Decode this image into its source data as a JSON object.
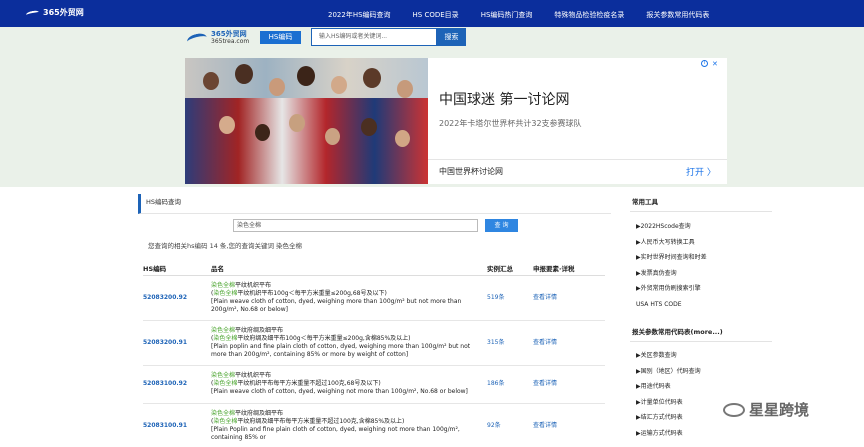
{
  "topbar": {
    "logo": "365外贸网",
    "nav": [
      "2022年HS编码查询",
      "HS CODE目录",
      "HS编码热门查询",
      "特殊物品检验检疫名录",
      "报关参数常用代码表"
    ]
  },
  "header": {
    "logo_name": "365外贸网",
    "logo_url": "365trea.com",
    "hs_button": "HS编码",
    "search_placeholder": "输入HS编码或者关键词...",
    "search_button": "搜索"
  },
  "ad": {
    "title": "中国球迷 第一讨论网",
    "subtitle": "2022年卡塔尔世界杯共计32支参赛球队",
    "footer": "中国世界杯讨论网",
    "open_button": "打开 〉",
    "close": "✕"
  },
  "main": {
    "tab": "HS编码查询",
    "query_value": "染色全棉",
    "query_button": "查 询",
    "result_summary": "您查询的相关hs编码 14 条,您的查询关键词 染色全棉",
    "columns": [
      "HS编码",
      "品名",
      "实例汇总",
      "申报要素·详税"
    ],
    "rows": [
      {
        "code": "52083200.92",
        "name_hl": "染色全棉",
        "name_rest": "平纹机织平布",
        "line2_hl": "染色全棉",
        "line2_rest": "平纹机织平布100g＜每平方米重量≤200g,68号及以下)",
        "english": "[Plain weave cloth of cotton, dyed, weighing more than 100g/m² but not more than 200g/m², No.68 or below]",
        "count": "519条",
        "detail": "查看详情"
      },
      {
        "code": "52083200.91",
        "name_hl": "染色全棉",
        "name_rest": "平纹府绸及细平布",
        "line2_hl": "染色全棉",
        "line2_rest": "平纹府绸及细平布100g＜每平方米重量≤200g,含棉85%及以上)",
        "english": "[Plain poplin and fine plain cloth of cotton, dyed, weighing more than 100g/m² but not more than 200g/m², containing 85% or more by weight of cotton]",
        "count": "315条",
        "detail": "查看详情"
      },
      {
        "code": "52083100.92",
        "name_hl": "染色全棉",
        "name_rest": "平纹机织平布",
        "line2_hl": "染色全棉",
        "line2_rest": "平纹机织平布每平方米重量不超过100克,68号及以下)",
        "english": "[Plain weave cloth of cotton, dyed, weighing not more than 100g/m², No.68 or below]",
        "count": "186条",
        "detail": "查看详情"
      },
      {
        "code": "52083100.91",
        "name_hl": "染色全棉",
        "name_rest": "平纹府绸及细平布",
        "line2_hl": "染色全棉",
        "line2_rest": "平纹府绸及细平布每平方米重量不超过100克,含棉85%及以上)",
        "english": "[Plain Poplin and fine plain cloth of cotton, dyed, weighing not more than 100g/m², containing 85% or",
        "count": "92条",
        "detail": "查看详情"
      }
    ]
  },
  "sidebar": {
    "tools_title": "常用工具",
    "tools": [
      "▶2022HScode查询",
      "▶人民币大写转换工具",
      "▶实时世界时间查询和时差",
      "▶发票真伪查询",
      "▶外贸常用伪刷搜索引擎",
      "USA HTS CODE"
    ],
    "params_title": "报关参数常用代码表(more...)",
    "params": [
      "▶关区参数查询",
      "▶国别（地区）代码查询",
      "▶用途代码表",
      "▶计量单位代码表",
      "▶结汇方式代码表",
      "▶运输方式代码表"
    ]
  },
  "watermark": "星星跨境",
  "colors": {
    "nav_bg": "#0b2e9c",
    "accent": "#1d63b7",
    "highlight": "#4aa52e"
  }
}
